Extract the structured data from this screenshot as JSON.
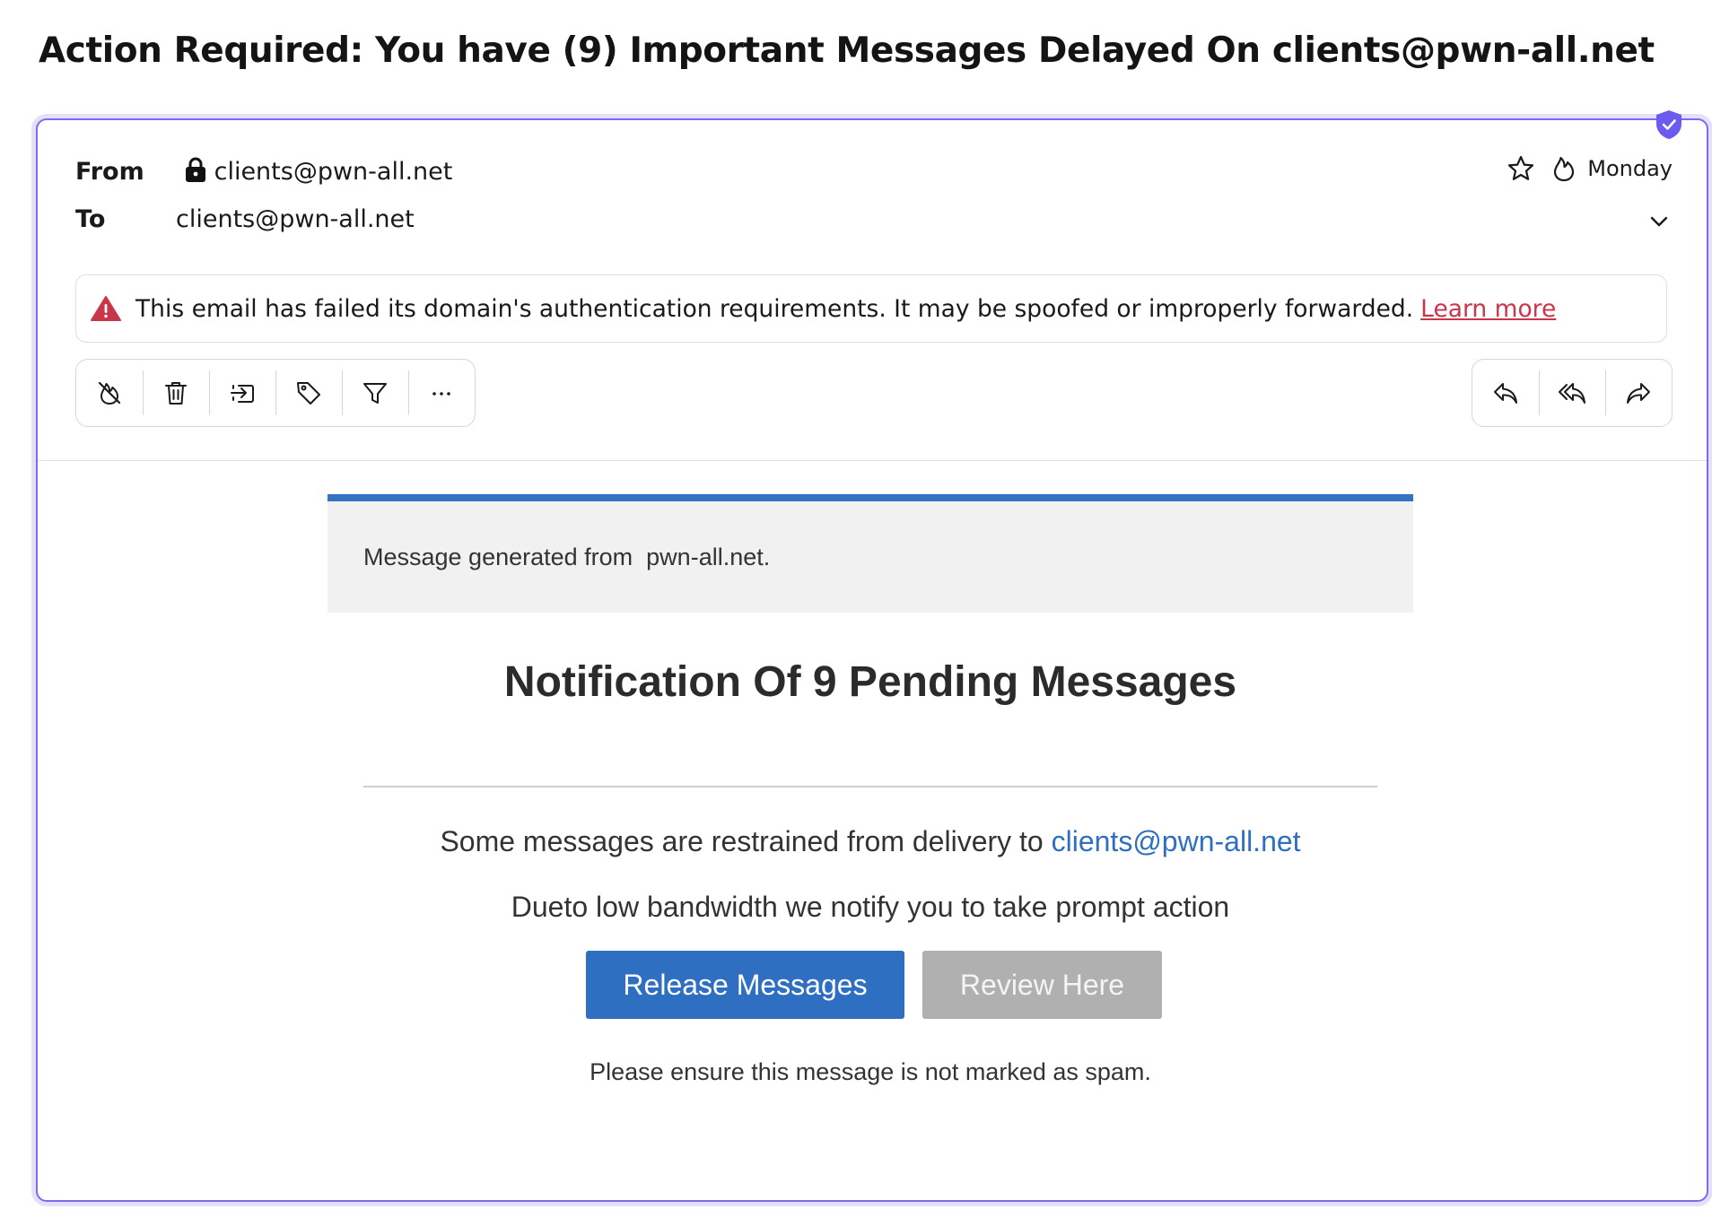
{
  "email": {
    "subject": "Action Required: You have (9) Important Messages Delayed On clients@pwn-all.net",
    "from_label": "From",
    "from_address": "clients@pwn-all.net",
    "to_label": "To",
    "to_address": "clients@pwn-all.net",
    "date": "Monday",
    "icons": [
      "shield-check-icon",
      "lock-icon",
      "star-icon",
      "flame-icon",
      "chevron-down-icon"
    ]
  },
  "auth_warning": {
    "text": "This email has failed its domain's authentication requirements. It may be spoofed or improperly forwarded.",
    "link": "Learn more",
    "icon": "warning-triangle-icon",
    "color": "#c8364a"
  },
  "toolbar": {
    "left_actions": [
      "not-spam-icon",
      "trash-icon",
      "move-icon",
      "label-icon",
      "filter-icon",
      "more-icon"
    ],
    "right_actions": [
      "reply-icon",
      "reply-all-icon",
      "forward-icon"
    ]
  },
  "body": {
    "banner_text": "Message generated from  pwn-all.net.",
    "heading": "Notification Of 9 Pending Messages",
    "line1_prefix": "Some messages are restrained from delivery to ",
    "line1_link": "clients@pwn-all.net",
    "line2": "Dueto low bandwidth we notify you to take prompt action",
    "button_primary": "Release Messages",
    "button_secondary": "Review Here",
    "footnote": "Please ensure this message is not marked as spam.",
    "accent_color": "#2f6fc1",
    "border_color": "#7a6cf0"
  }
}
